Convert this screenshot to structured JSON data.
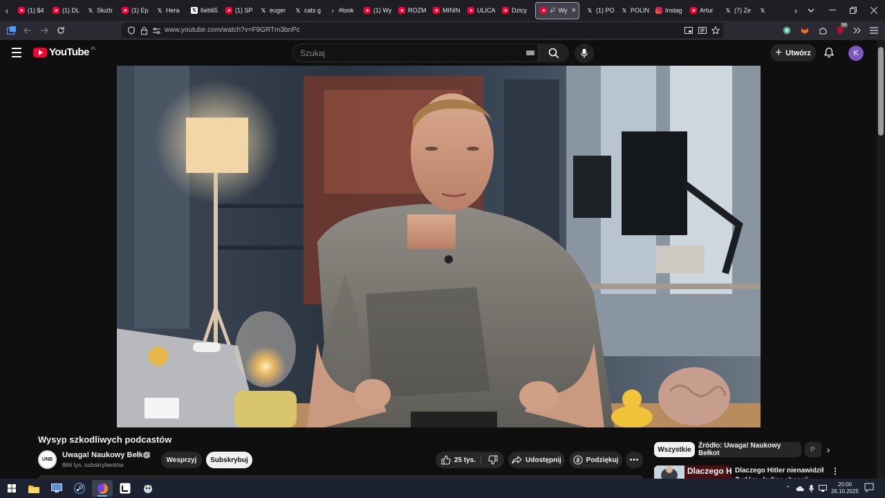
{
  "browser": {
    "tabs": [
      {
        "icon": "yt",
        "label": "(1) $4"
      },
      {
        "icon": "yt",
        "label": "(1) DL"
      },
      {
        "icon": "x",
        "label": "Służb"
      },
      {
        "icon": "yt",
        "label": "(1) Ep"
      },
      {
        "icon": "x",
        "label": "Hera"
      },
      {
        "icon": "xb",
        "label": "6eb65"
      },
      {
        "icon": "yt",
        "label": "(1) SP"
      },
      {
        "icon": "x",
        "label": "euger"
      },
      {
        "icon": "x",
        "label": "cats g"
      },
      {
        "icon": "tt",
        "label": "#look"
      },
      {
        "icon": "yt",
        "label": "(1) Wy"
      },
      {
        "icon": "yt",
        "label": "ROZM"
      },
      {
        "icon": "yt",
        "label": "MININ"
      },
      {
        "icon": "yt",
        "label": "ULICA"
      },
      {
        "icon": "yt",
        "label": "Dzicy"
      },
      {
        "icon": "yt",
        "label": "Wy",
        "active": true
      },
      {
        "icon": "x",
        "label": "(1) PO"
      },
      {
        "icon": "x",
        "label": "POLIN"
      },
      {
        "icon": "ig",
        "label": "Instag"
      },
      {
        "icon": "yt",
        "label": "Artur"
      },
      {
        "icon": "x",
        "label": "(7) Ze"
      },
      {
        "icon": "x",
        "label": ""
      }
    ],
    "url": "www.youtube.com/watch?v=F9GRTm3bnPc",
    "extension_badge": "56"
  },
  "youtube": {
    "logo_text": "YouTube",
    "country_code": "PL",
    "search_placeholder": "Szukaj",
    "create_label": "Utwórz",
    "avatar_letter": "K"
  },
  "video": {
    "title": "Wysyp szkodliwych podcastów",
    "channel_name": "Uwaga! Naukowy Bełkot",
    "channel_avatar_text": "UNB",
    "subscribers": "866 tys. subskrybentów",
    "support_label": "Wesprzyj",
    "subscribe_label": "Subskrybuj",
    "likes": "25 tys.",
    "share_label": "Udostępnij",
    "thanks_label": "Podziękuj",
    "more_label": "•••"
  },
  "sidebar": {
    "chips": [
      "Wszystkie",
      "Źródło: Uwaga! Naukowy Bełkot",
      "P"
    ],
    "recommended": [
      {
        "thumb_text": "Dlaczego Hitler",
        "title": "Dlaczego Hitler nienawidził Żydów - kulisy obsesji"
      }
    ]
  },
  "taskbar": {
    "time": "20:00",
    "date": "26.10.2025"
  },
  "colors": {
    "youtube_red": "#ff0033",
    "background": "#0f0f0f",
    "avatar": "#7e57c2",
    "taskbar": "#1c2230"
  }
}
